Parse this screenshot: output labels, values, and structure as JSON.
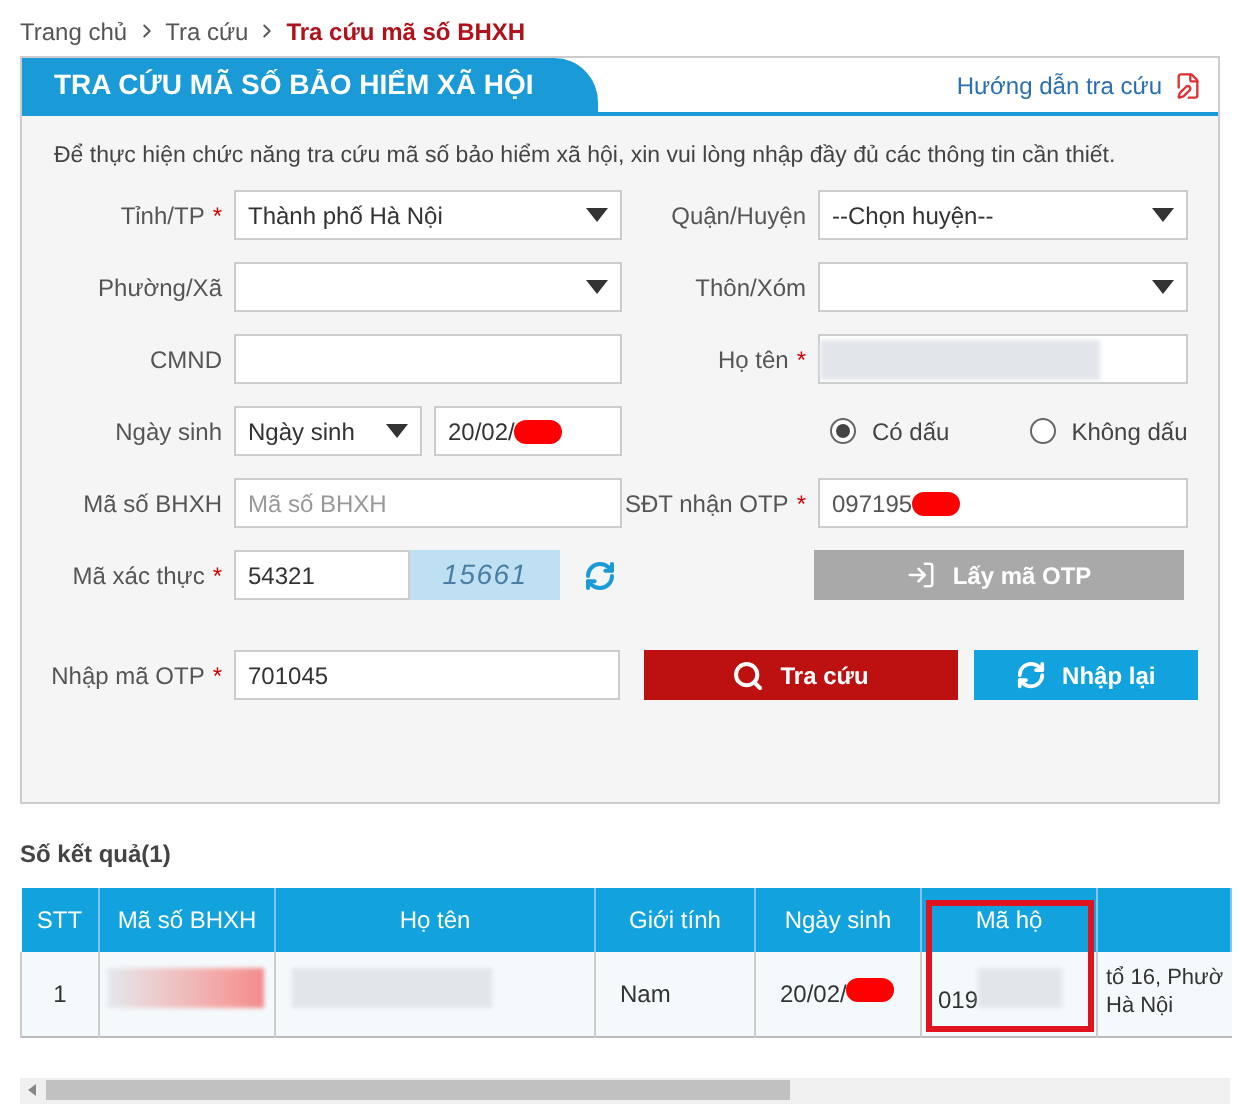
{
  "breadcrumb": [
    {
      "label": "Trang chủ",
      "current": false
    },
    {
      "label": "Tra cứu",
      "current": false
    },
    {
      "label": "Tra cứu mã số BHXH",
      "current": true
    }
  ],
  "panel": {
    "title": "TRA CỨU MÃ SỐ BẢO HIỂM XÃ HỘI",
    "help_link": "Hướng dẫn tra cứu",
    "intro": "Để thực hiện chức năng tra cứu mã số bảo hiểm xã hội, xin vui lòng nhập đầy đủ các thông tin cần thiết."
  },
  "form": {
    "province": {
      "label": "Tỉnh/TP",
      "required_mark": "*",
      "value": "Thành phố Hà Nội"
    },
    "district": {
      "label": "Quận/Huyện",
      "value": "--Chọn huyện--"
    },
    "ward": {
      "label": "Phường/Xã"
    },
    "village": {
      "label": "Thôn/Xóm"
    },
    "id_card": {
      "label": "CMND"
    },
    "full_name": {
      "label": "Họ tên",
      "required_mark": "*",
      "redacted": true
    },
    "birth": {
      "label": "Ngày sinh",
      "type_value": "Ngày sinh",
      "value": "20/02/",
      "redacted": true
    },
    "accent_options": [
      {
        "label": "Có dấu",
        "selected": true
      },
      {
        "label": "Không dấu",
        "selected": false
      }
    ],
    "insurance_code": {
      "label": "Mã số BHXH",
      "placeholder": "Mã số BHXH"
    },
    "phone": {
      "label": "SĐT nhận OTP",
      "required_mark": "*",
      "value": "097195",
      "redacted": true
    },
    "captcha": {
      "label": "Mã xác thực",
      "required_mark": "*",
      "value": "54321",
      "image_text": "15661"
    },
    "otp_button": {
      "label": "Lấy mã OTP",
      "disabled": true
    },
    "otp": {
      "label": "Nhập mã OTP",
      "required_mark": "*",
      "value": "701045"
    },
    "search_button": "Tra cứu",
    "reset_button": "Nhập lại"
  },
  "results": {
    "title": "Số kết quả(1)",
    "columns": [
      {
        "label": "STT",
        "highlighted": false
      },
      {
        "label": "Mã số BHXH",
        "highlighted": false
      },
      {
        "label": "Họ tên",
        "highlighted": false
      },
      {
        "label": "Giới tính",
        "highlighted": false
      },
      {
        "label": "Ngày sinh",
        "highlighted": false
      },
      {
        "label": "Mã hộ",
        "highlighted": true
      },
      {
        "highlighted": false
      }
    ],
    "rows": [
      {
        "stt": "1",
        "code_redacted": true,
        "name_redacted": true,
        "gender": "Nam",
        "birth": "20/02/",
        "birth_redacted": true,
        "household": "019",
        "household_redacted": true,
        "address_lines": [
          "tổ 16, Phườ",
          "Hà Nội"
        ]
      }
    ]
  }
}
